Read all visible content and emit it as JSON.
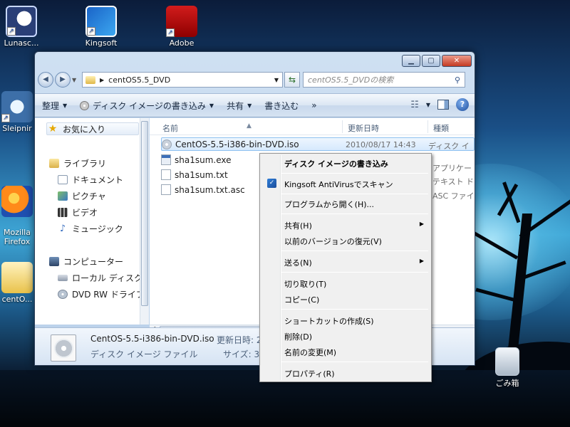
{
  "desktop": {
    "icons": [
      {
        "label": "Lunasc..."
      },
      {
        "label": "Kingsoft"
      },
      {
        "label": "Adobe"
      },
      {
        "label": "Sleipnir"
      },
      {
        "label": "Mozilla\nFirefox"
      },
      {
        "label": "centO..."
      },
      {
        "label": "ごみ箱"
      }
    ]
  },
  "window": {
    "controls": {
      "minimize": "▁",
      "maximize": "▢",
      "close": "✕"
    },
    "address": {
      "path": "centOS5.5_DVD"
    },
    "search": {
      "placeholder": "centOS5.5_DVDの検索"
    },
    "toolbar": {
      "organize": "整理",
      "burn_image": "ディスク イメージの書き込み",
      "share": "共有",
      "burn": "書き込む",
      "more": "»"
    },
    "nav": {
      "favorites": "お気に入り",
      "library": "ライブラリ",
      "documents": "ドキュメント",
      "pictures": "ピクチャ",
      "videos": "ビデオ",
      "music": "ミュージック",
      "computer": "コンピューター",
      "local_disk": "ローカル ディスク",
      "dvd_drive": "DVD RW ドライブ"
    },
    "columns": {
      "name": "名前",
      "modified": "更新日時",
      "type": "種類"
    },
    "files": [
      {
        "name": "CentOS-5.5-i386-bin-DVD.iso",
        "date": "2010/08/17 14:43",
        "type": "ディスク イ"
      },
      {
        "name": "sha1sum.exe",
        "type": "アプリケー"
      },
      {
        "name": "sha1sum.txt",
        "type": "テキスト ド"
      },
      {
        "name": "sha1sum.txt.asc",
        "type": "ASC ファイ"
      }
    ],
    "details": {
      "name": "CentOS-5.5-i386-bin-DVD.iso",
      "type": "ディスク イメージ ファイル",
      "modified_label": "更新日時: 2",
      "size_label": "サイズ: 3"
    }
  },
  "context_menu": {
    "items": [
      {
        "label": "ディスク イメージの書き込み"
      },
      {
        "label": "Kingsoft AntiVirusでスキャン"
      },
      {
        "label": "プログラムから開く(H)..."
      },
      {
        "label": "共有(H)",
        "arrow": "▶"
      },
      {
        "label": "以前のバージョンの復元(V)"
      },
      {
        "label": "送る(N)",
        "arrow": "▶"
      },
      {
        "label": "切り取り(T)"
      },
      {
        "label": "コピー(C)"
      },
      {
        "label": "ショートカットの作成(S)"
      },
      {
        "label": "削除(D)"
      },
      {
        "label": "名前の変更(M)"
      },
      {
        "label": "プロパティ(R)"
      }
    ]
  }
}
